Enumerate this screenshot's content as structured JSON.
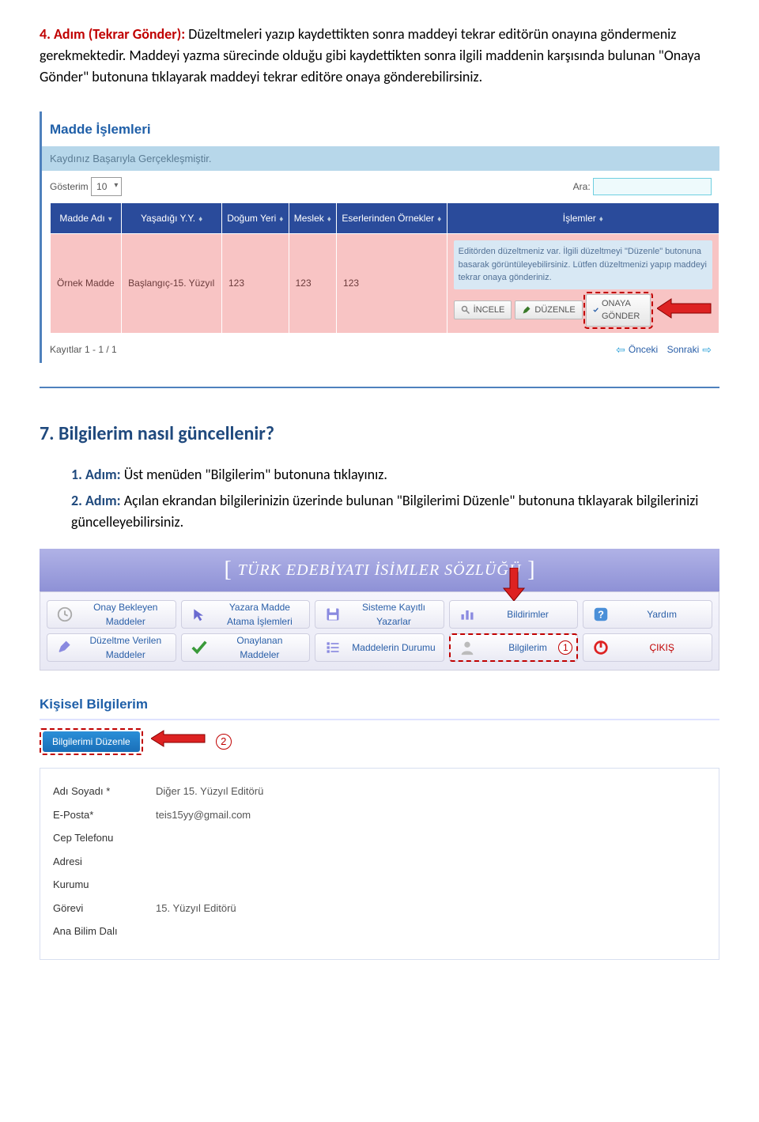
{
  "doc": {
    "step4_label": "4. Adım (Tekrar Gönder):",
    "step4_text": " Düzeltmeleri yazıp kaydettikten sonra maddeyi tekrar editörün onayına göndermeniz gerekmektedir. Maddeyi yazma sürecinde olduğu gibi kaydettikten sonra ilgili maddenin karşısında bulunan \"Onaya Gönder\" butonuna tıklayarak maddeyi tekrar editöre onaya gönderebilirsiniz.",
    "section7": "7. Bilgilerim nasıl güncellenir?",
    "step1_label": "1. Adım:",
    "step1_text": " Üst menüden \"Bilgilerim\" butonuna tıklayınız.",
    "step2_label": "2. Adım:",
    "step2_text": " Açılan ekrandan bilgilerinizin üzerinde bulunan \"Bilgilerimi Düzenle\" butonuna tıklayarak bilgilerinizi güncelleyebilirsiniz."
  },
  "shot1": {
    "panel_title": "Madde İşlemleri",
    "success": "Kaydınız Başarıyla Gerçekleşmiştir.",
    "show_label": "Gösterim",
    "show_value": "10",
    "search_label": "Ara:",
    "search_value": "",
    "headers": {
      "h1": "Madde Adı",
      "h2": "Yaşadığı Y.Y.",
      "h3": "Doğum Yeri",
      "h4": "Meslek",
      "h5": "Eserlerinden Örnekler",
      "h6": "İşlemler"
    },
    "row": {
      "c1": "Örnek Madde",
      "c2": "Başlangıç-15. Yüzyıl",
      "c3": "123",
      "c4": "123",
      "c5": "123",
      "ops_msg": "Editörden düzeltmeniz var. İlgili düzeltmeyi \"Düzenle\" butonuna basarak görüntüleyebilirsiniz. Lütfen düzeltmenizi yapıp maddeyi tekrar onaya gönderiniz.",
      "btn_incele": "İNCELE",
      "btn_duzenle": "DÜZENLE",
      "btn_onaya": "ONAYA GÖNDER"
    },
    "pager_left": "Kayıtlar 1 - 1 / 1",
    "pager_prev": "Önceki",
    "pager_next": "Sonraki"
  },
  "shot2": {
    "app_title": "TÜRK EDEBİYATI İSİMLER SÖZLÜĞÜ",
    "menu": {
      "r1": [
        "Onay Bekleyen Maddeler",
        "Yazara Madde Atama İşlemleri",
        "Sisteme Kayıtlı Yazarlar",
        "Bildirimler",
        "Yardım"
      ],
      "r2": [
        "Düzeltme Verilen Maddeler",
        "Onaylanan Maddeler",
        "Maddelerin Durumu",
        "Bilgilerim",
        "ÇIKIŞ"
      ]
    },
    "badge1": "1",
    "kisi_title": "Kişisel Bilgilerim",
    "edit_btn": "Bilgilerimi Düzenle",
    "badge2": "2",
    "info": {
      "l1": "Adı Soyadı *",
      "v1": "Diğer 15. Yüzyıl Editörü",
      "l2": "E-Posta*",
      "v2": "teis15yy@gmail.com",
      "l3": "Cep Telefonu",
      "v3": "",
      "l4": "Adresi",
      "v4": "",
      "l5": "Kurumu",
      "v5": "",
      "l6": "Görevi",
      "v6": "15. Yüzyıl Editörü",
      "l7": "Ana Bilim Dalı",
      "v7": ""
    }
  }
}
